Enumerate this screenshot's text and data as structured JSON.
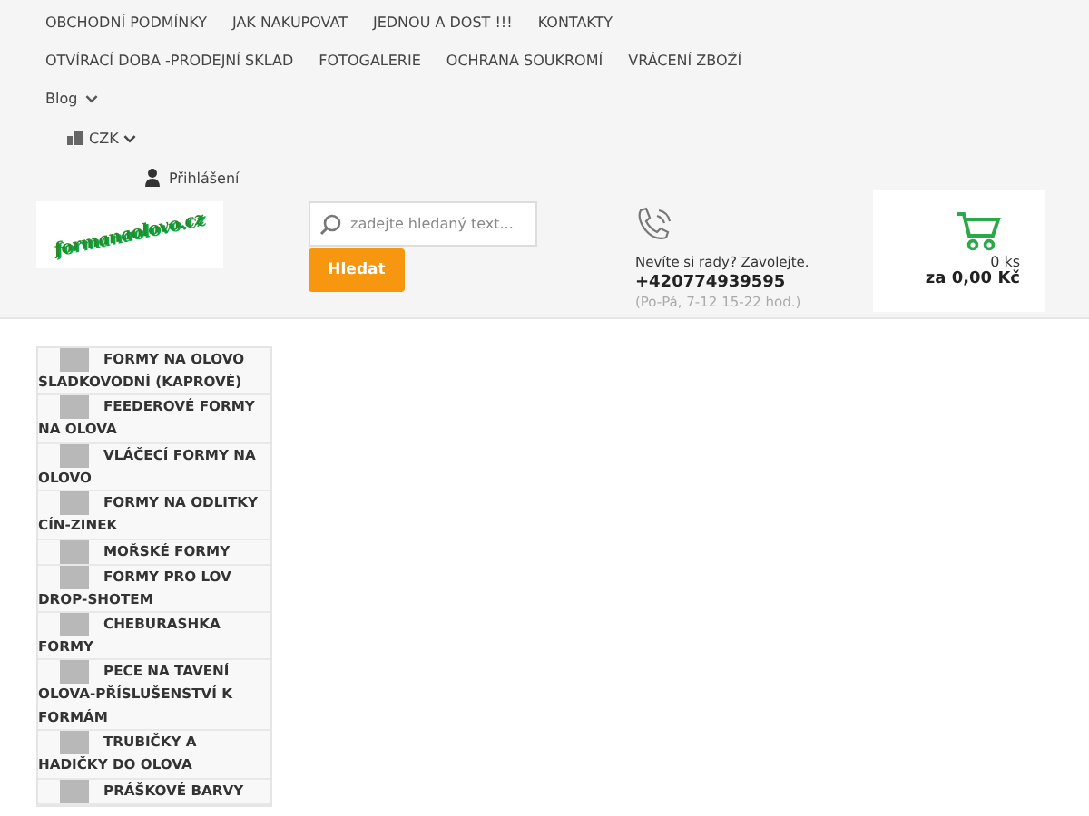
{
  "top_menu": [
    {
      "label": "OBCHODNÍ PODMÍNKY"
    },
    {
      "label": "JAK NAKUPOVAT"
    },
    {
      "label": "JEDNOU A DOST !!!"
    },
    {
      "label": "KONTAKTY"
    },
    {
      "label": "OTVÍRACÍ DOBA -PRODEJNÍ SKLAD"
    },
    {
      "label": "FOTOGALERIE"
    },
    {
      "label": "OCHRANA SOUKROMÍ"
    },
    {
      "label": "VRÁCENÍ ZBOŽÍ"
    },
    {
      "label": "Blog"
    }
  ],
  "currency": "CZK",
  "login": "Přihlášení",
  "logo": "formanaolovo.cz",
  "search": {
    "placeholder": "zadejte hledaný text...",
    "button": "Hledat"
  },
  "contact": {
    "prompt": "Nevíte si rady? Zavolejte.",
    "phone": "+420774939595",
    "hours": "(Po-Pá, 7-12 15-22 hod.)"
  },
  "cart": {
    "count": "0 ks",
    "total": "za 0,00 Kč"
  },
  "categories": [
    {
      "label": "FORMY NA OLOVO SLADKOVODNÍ (KAPROVÉ)"
    },
    {
      "label": "FEEDEROVÉ FORMY NA OLOVA"
    },
    {
      "label": "VLÁČECÍ FORMY NA OLOVO"
    },
    {
      "label": "FORMY NA ODLITKY CÍN-ZINEK"
    },
    {
      "label": "MOŘSKÉ FORMY"
    },
    {
      "label": "FORMY PRO LOV DROP-SHOTEM"
    },
    {
      "label": "CHEBURASHKA FORMY"
    },
    {
      "label": "PECE NA TAVENÍ OLOVA-PŘÍSLUŠENSTVÍ K FORMÁM"
    },
    {
      "label": "TRUBIČKY A HADIČKY DO OLOVA"
    },
    {
      "label": "PRÁŠKOVÉ BARVY"
    }
  ]
}
